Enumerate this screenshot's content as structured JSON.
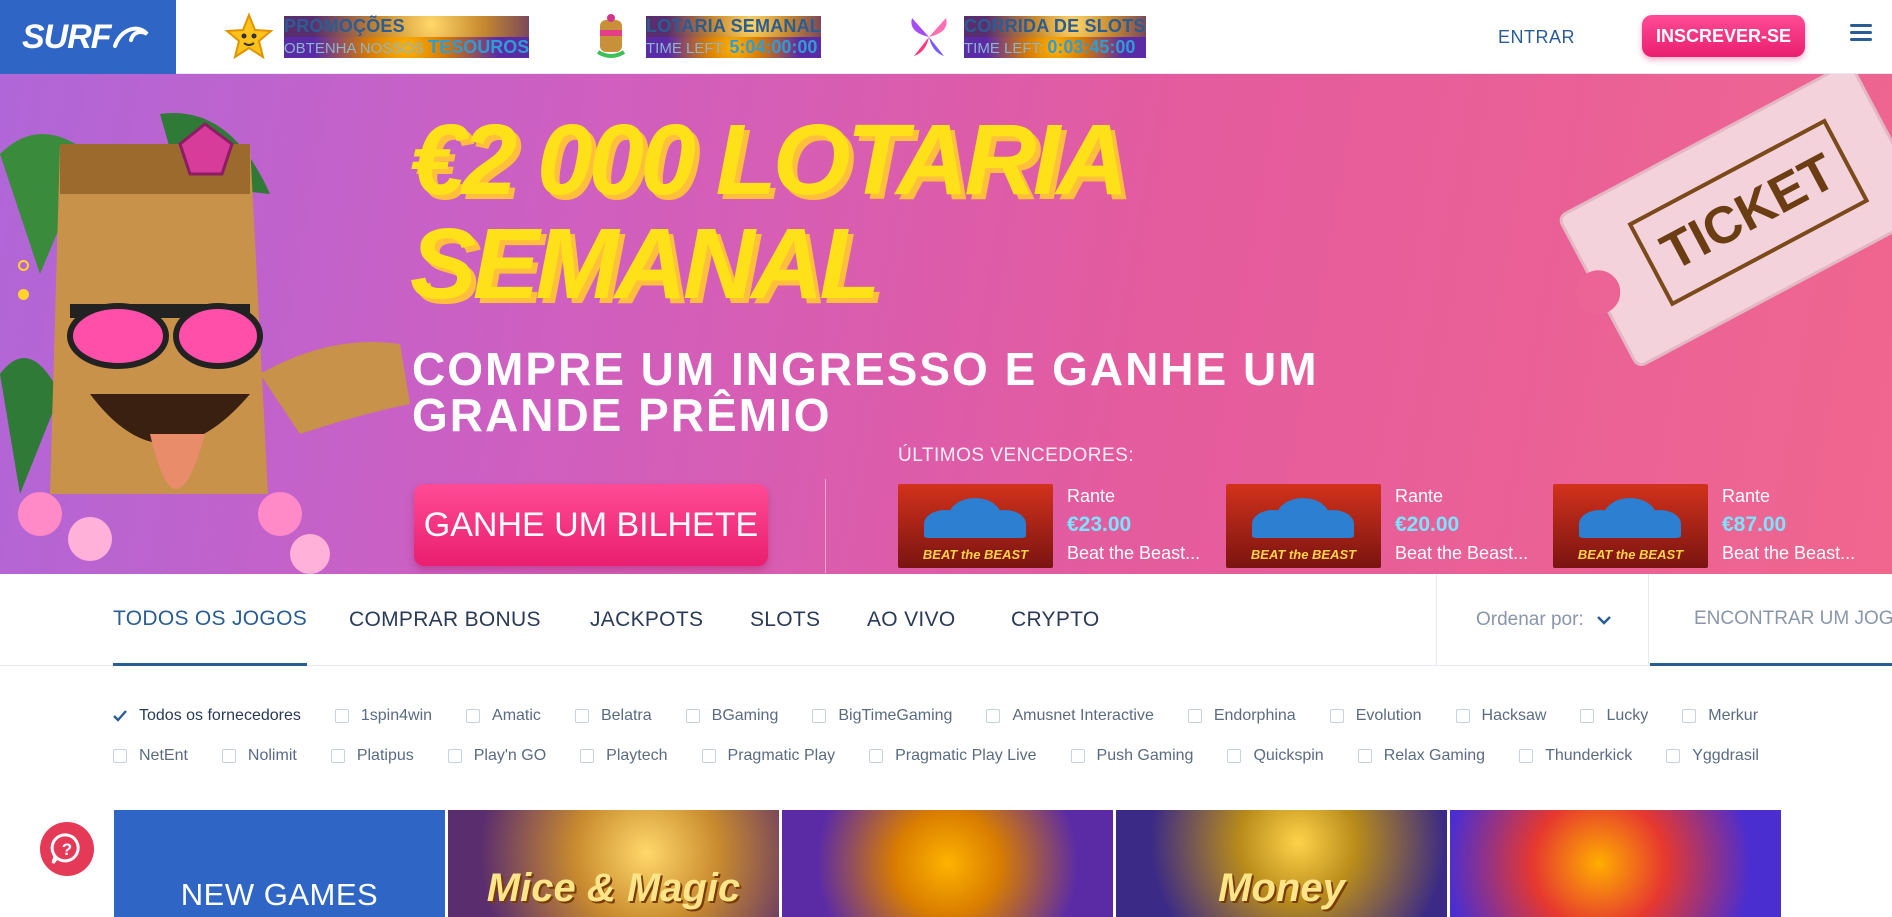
{
  "header": {
    "logo": "SURF",
    "promos": [
      {
        "title": "PROMOÇÕES",
        "sub_prefix": "OBTENHA NOSSOS",
        "sub_value": "TESOUROS"
      },
      {
        "title": "LOTARIA SEMANAL",
        "sub_prefix": "TIME LEFT:",
        "sub_value": "5:04:00:00"
      },
      {
        "title": "CORRIDA DE SLOTS",
        "sub_prefix": "TIME LEFT:",
        "sub_value": "0:03:45:00"
      }
    ],
    "login_label": "ENTRAR",
    "signup_label": "INSCREVER-SE"
  },
  "hero": {
    "title_line1": "€2 000 LOTARIA",
    "title_line2": "SEMANAL",
    "subtitle": "COMPRE UM INGRESSO E GANHE UM GRANDE PRÊMIO",
    "cta_label": "GANHE UM BILHETE",
    "winners_label": "ÚLTIMOS VENCEDORES:",
    "ticket_label": "TICKET",
    "winners": [
      {
        "name": "Rante",
        "amount": "€23.00",
        "game": "Beat the Beast..."
      },
      {
        "name": "Rante",
        "amount": "€20.00",
        "game": "Beat the Beast..."
      },
      {
        "name": "Rante",
        "amount": "€87.00",
        "game": "Beat the Beast..."
      }
    ],
    "thumb_label": "BEAT the BEAST"
  },
  "tabs": [
    {
      "label": "TODOS OS JOGOS",
      "active": true
    },
    {
      "label": "COMPRAR BONUS"
    },
    {
      "label": "JACKPOTS"
    },
    {
      "label": "SLOTS"
    },
    {
      "label": "AO VIVO"
    },
    {
      "label": "CRYPTO"
    }
  ],
  "sort_label": "Ordenar por:",
  "search": {
    "placeholder": "ENCONTRAR UM JOGO"
  },
  "providers_row1": [
    "Todos os fornecedores",
    "1spin4win",
    "Amatic",
    "Belatra",
    "BGaming",
    "BigTimeGaming",
    "Amusnet Interactive",
    "Endorphina",
    "Evolution",
    "Hacksaw",
    "Lucky",
    "Merkur"
  ],
  "providers_row2": [
    "NetEnt",
    "Nolimit",
    "Platipus",
    "Play'n GO",
    "Playtech",
    "Pragmatic Play",
    "Pragmatic Play Live",
    "Push Gaming",
    "Quickspin",
    "Relax Gaming",
    "Thunderkick",
    "Yggdrasil"
  ],
  "games": {
    "new_label": "NEW GAMES",
    "tiles": [
      "Mice & Magic",
      "",
      "Money",
      ""
    ]
  },
  "colors": {
    "brand": "#2f66c6",
    "accent": "#e91e6f",
    "hero_title": "#ffe11a"
  }
}
